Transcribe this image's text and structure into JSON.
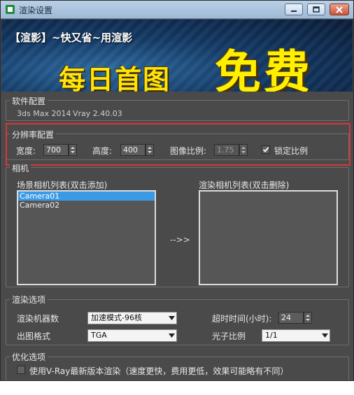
{
  "window": {
    "title": "渲染设置"
  },
  "banner": {
    "tagline": "【渲影】~快又省~用渲影",
    "headline": "每日首图",
    "highlight": "免费"
  },
  "software": {
    "group_title": "软件配置",
    "max_version": "3ds Max 2014",
    "vray_version": "Vray 2.40.03"
  },
  "resolution": {
    "group_title": "分辨率配置",
    "width_label": "宽度:",
    "width_value": "700",
    "height_label": "高度:",
    "height_value": "400",
    "ratio_label": "图像比例:",
    "ratio_value": "1.75",
    "lock_label": "锁定比例",
    "lock_checked": true
  },
  "camera": {
    "group_title": "相机",
    "scene_list_label": "场景相机列表(双击添加)",
    "render_list_label": "渲染相机列表(双击删除)",
    "scene_cameras": [
      "Camera01",
      "Camera02"
    ],
    "selected_index": 0,
    "render_cameras": [],
    "transfer_arrow": "-->>"
  },
  "render_options": {
    "group_title": "渲染选项",
    "machines_label": "渲染机器数",
    "machines_value": "加速模式-96核",
    "timeout_label": "超时时间(小时):",
    "timeout_value": "24",
    "format_label": "出图格式",
    "format_value": "TGA",
    "photon_label": "光子比例",
    "photon_value": "1/1"
  },
  "optimize": {
    "group_title": "优化选项",
    "new_vray_label": "使用V-Ray最新版本渲染（速度更快，费用更低，效果可能略有不同）",
    "new_vray_checked": false
  },
  "colors": {
    "panel_bg": "#4a4a4a",
    "highlight_border": "#d8373a",
    "selected_item": "#3a9ae6",
    "banner_yellow": "#ffe30a"
  }
}
